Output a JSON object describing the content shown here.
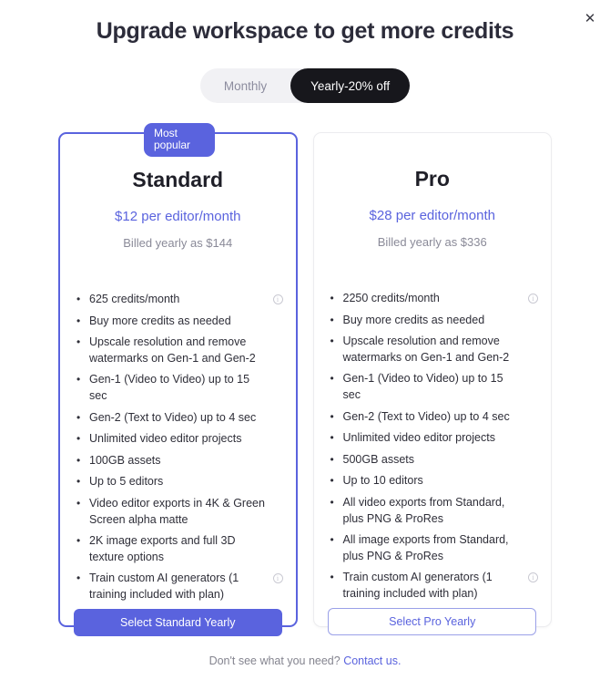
{
  "modal": {
    "title": "Upgrade workspace to get more credits",
    "close_label": "✕",
    "close_icon": "close-icon"
  },
  "billing_toggle": {
    "monthly_label": "Monthly",
    "yearly_label": "Yearly-20% off",
    "selected": "Yearly-20% off"
  },
  "colors": {
    "accent": "#5a63de",
    "active_pill": "#17171c",
    "track": "#f1f1f4",
    "muted_text": "#8a8a98"
  },
  "plans": [
    {
      "badge": "Most popular",
      "name": "Standard",
      "price": "$12 per editor/month",
      "billed": "Billed yearly as $144",
      "features": [
        {
          "text": "625 credits/month",
          "info": true
        },
        {
          "text": "Buy more credits as needed",
          "info": false
        },
        {
          "text": "Upscale resolution and remove watermarks on Gen-1 and Gen-2",
          "info": false
        },
        {
          "text": "Gen-1 (Video to Video) up to 15 sec",
          "info": false
        },
        {
          "text": "Gen-2 (Text to Video) up to 4 sec",
          "info": false
        },
        {
          "text": "Unlimited video editor projects",
          "info": false
        },
        {
          "text": "100GB assets",
          "info": false
        },
        {
          "text": "Up to 5 editors",
          "info": false
        },
        {
          "text": "Video editor exports in 4K & Green Screen alpha matte",
          "info": false
        },
        {
          "text": "2K image exports and full 3D texture options",
          "info": false
        },
        {
          "text": "Train custom AI generators (1 training included with plan)",
          "info": true
        }
      ],
      "cta": "Select Standard Yearly",
      "cta_style": "filled"
    },
    {
      "badge": null,
      "name": "Pro",
      "price": "$28 per editor/month",
      "billed": "Billed yearly as $336",
      "features": [
        {
          "text": "2250 credits/month",
          "info": true
        },
        {
          "text": "Buy more credits as needed",
          "info": false
        },
        {
          "text": "Upscale resolution and remove watermarks on Gen-1 and Gen-2",
          "info": false
        },
        {
          "text": "Gen-1 (Video to Video) up to 15 sec",
          "info": false
        },
        {
          "text": "Gen-2 (Text to Video) up to 4 sec",
          "info": false
        },
        {
          "text": "Unlimited video editor projects",
          "info": false
        },
        {
          "text": "500GB assets",
          "info": false
        },
        {
          "text": "Up to 10 editors",
          "info": false
        },
        {
          "text": "All video exports from Standard, plus PNG & ProRes",
          "info": false
        },
        {
          "text": "All image exports from Standard, plus PNG & ProRes",
          "info": false
        },
        {
          "text": "Train custom AI generators (1 training included with plan)",
          "info": true
        }
      ],
      "cta": "Select Pro Yearly",
      "cta_style": "outlined"
    }
  ],
  "footer": {
    "text": "Don't see what you need?",
    "link": "Contact us."
  }
}
